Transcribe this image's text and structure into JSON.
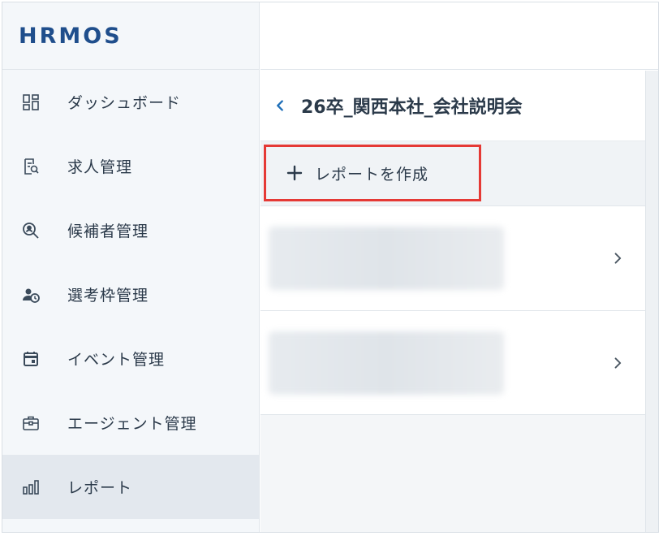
{
  "brand": {
    "logo_text": "HRMOS"
  },
  "sidebar": {
    "items": [
      {
        "label": "ダッシュボード",
        "icon": "dashboard-icon",
        "active": false
      },
      {
        "label": "求人管理",
        "icon": "job-document-icon",
        "active": false
      },
      {
        "label": "候補者管理",
        "icon": "candidate-search-icon",
        "active": false
      },
      {
        "label": "選考枠管理",
        "icon": "person-clock-icon",
        "active": false
      },
      {
        "label": "イベント管理",
        "icon": "calendar-icon",
        "active": false
      },
      {
        "label": "エージェント管理",
        "icon": "briefcase-icon",
        "active": false
      },
      {
        "label": "レポート",
        "icon": "bar-chart-icon",
        "active": true
      }
    ]
  },
  "main": {
    "title": "26卒_関西本社_会社説明会",
    "back_icon": "chevron-left-icon",
    "create_button": {
      "label": "レポートを作成",
      "icon": "plus-icon"
    },
    "list_rows": [
      {
        "chevron": "chevron-right-icon"
      },
      {
        "chevron": "chevron-right-icon"
      }
    ]
  },
  "colors": {
    "brand": "#1f4e8c",
    "accent_link": "#1f6fb8",
    "highlight_border": "#e53935",
    "sidebar_bg": "#f4f7fa",
    "active_bg": "#e3e8ee"
  }
}
